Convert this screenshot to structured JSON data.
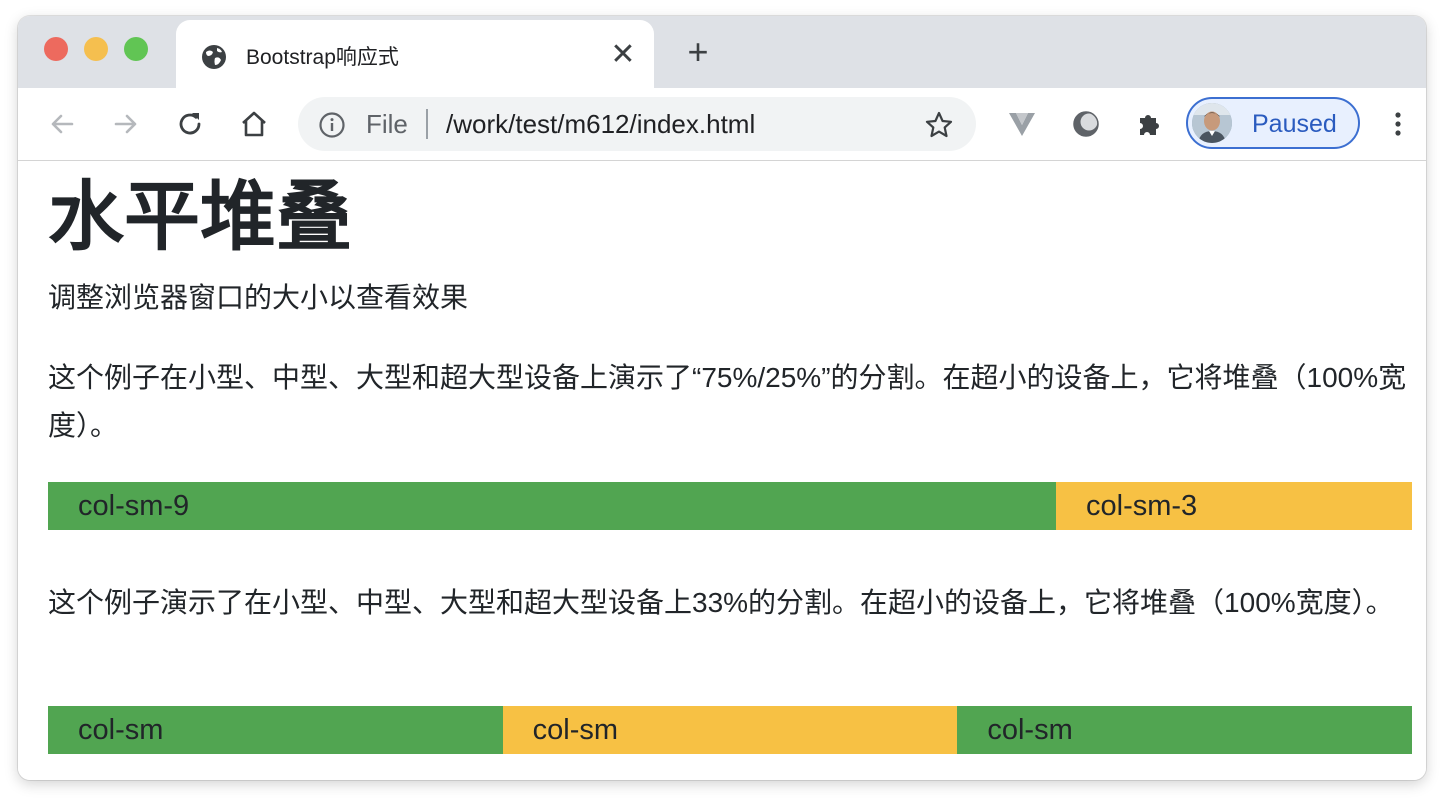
{
  "browser": {
    "tab": {
      "title": "Bootstrap响应式",
      "close_glyph": "✕"
    },
    "new_tab_glyph": "+",
    "address": {
      "scheme": "File",
      "path": "/work/test/m612/index.html"
    },
    "profile": {
      "label": "Paused"
    },
    "icons": {
      "back": "back-arrow-icon",
      "forward": "forward-arrow-icon",
      "reload": "reload-icon",
      "home": "home-icon",
      "info": "info-icon",
      "bookmark": "star-icon",
      "extension_v": "v-extension-icon",
      "extension_circle": "circle-extension-icon",
      "extensions": "puzzle-icon",
      "menu": "kebab-menu-icon"
    },
    "colors": {
      "tabstrip": "#dee1e6",
      "accent": "#3c6fd1",
      "traffic_close": "#ed6a5e",
      "traffic_min": "#f5bf4f",
      "traffic_max": "#61c554"
    }
  },
  "page": {
    "heading": "水平堆叠",
    "intro": "调整浏览器窗口的大小以查看效果",
    "example1": {
      "description": "这个例子在小型、中型、大型和超大型设备上演示了“75%/25%”的分割。在超小的设备上，它将堆叠（100%宽度）。",
      "columns": [
        {
          "label": "col-sm-9",
          "color": "#51a551",
          "span": 9
        },
        {
          "label": "col-sm-3",
          "color": "#f7c144",
          "span": 3
        }
      ]
    },
    "example2": {
      "description": "这个例子演示了在小型、中型、大型和超大型设备上33%的分割。在超小的设备上，它将堆叠（100%宽度）。",
      "columns": [
        {
          "label": "col-sm",
          "color": "#51a551",
          "span": 4
        },
        {
          "label": "col-sm",
          "color": "#f7c144",
          "span": 4
        },
        {
          "label": "col-sm",
          "color": "#51a551",
          "span": 4
        }
      ]
    }
  }
}
